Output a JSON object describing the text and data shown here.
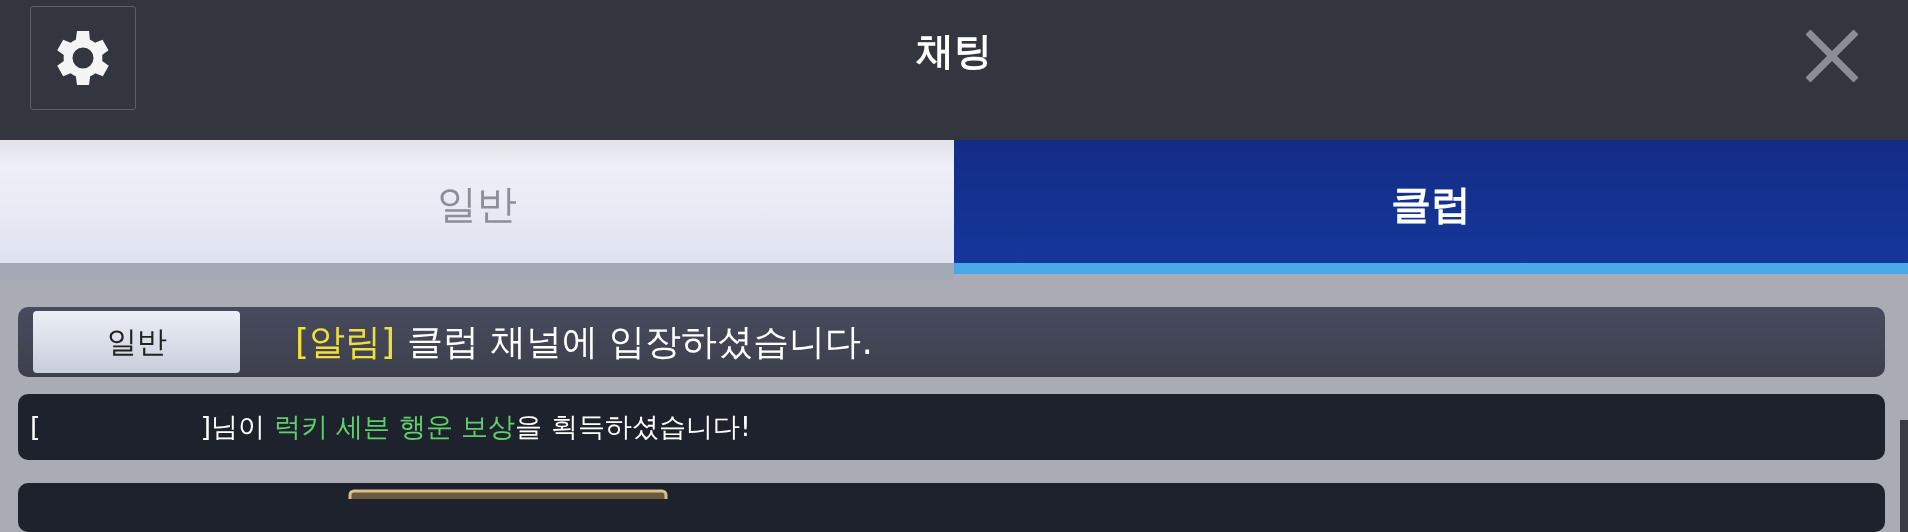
{
  "window": {
    "title": "채팅"
  },
  "tabs": [
    {
      "label": "일반",
      "selected": false
    },
    {
      "label": "클럽",
      "selected": true
    }
  ],
  "messages": [
    {
      "kind": "notice",
      "channel_badge": "일반",
      "segments": [
        {
          "text": "[알림]",
          "kind": "notice"
        },
        {
          "text": " 클럽 채널에 입장하셨습니다.",
          "kind": "plain"
        }
      ]
    },
    {
      "kind": "broadcast",
      "segments": [
        {
          "text": "[",
          "kind": "plain"
        },
        {
          "kind": "redacted"
        },
        {
          "text": "]님이 ",
          "kind": "plain"
        },
        {
          "text": "럭키 세븐 행운 보상",
          "kind": "highlight"
        },
        {
          "text": "을 획득하셨습니다!",
          "kind": "plain"
        }
      ]
    },
    {
      "kind": "item"
    }
  ]
}
